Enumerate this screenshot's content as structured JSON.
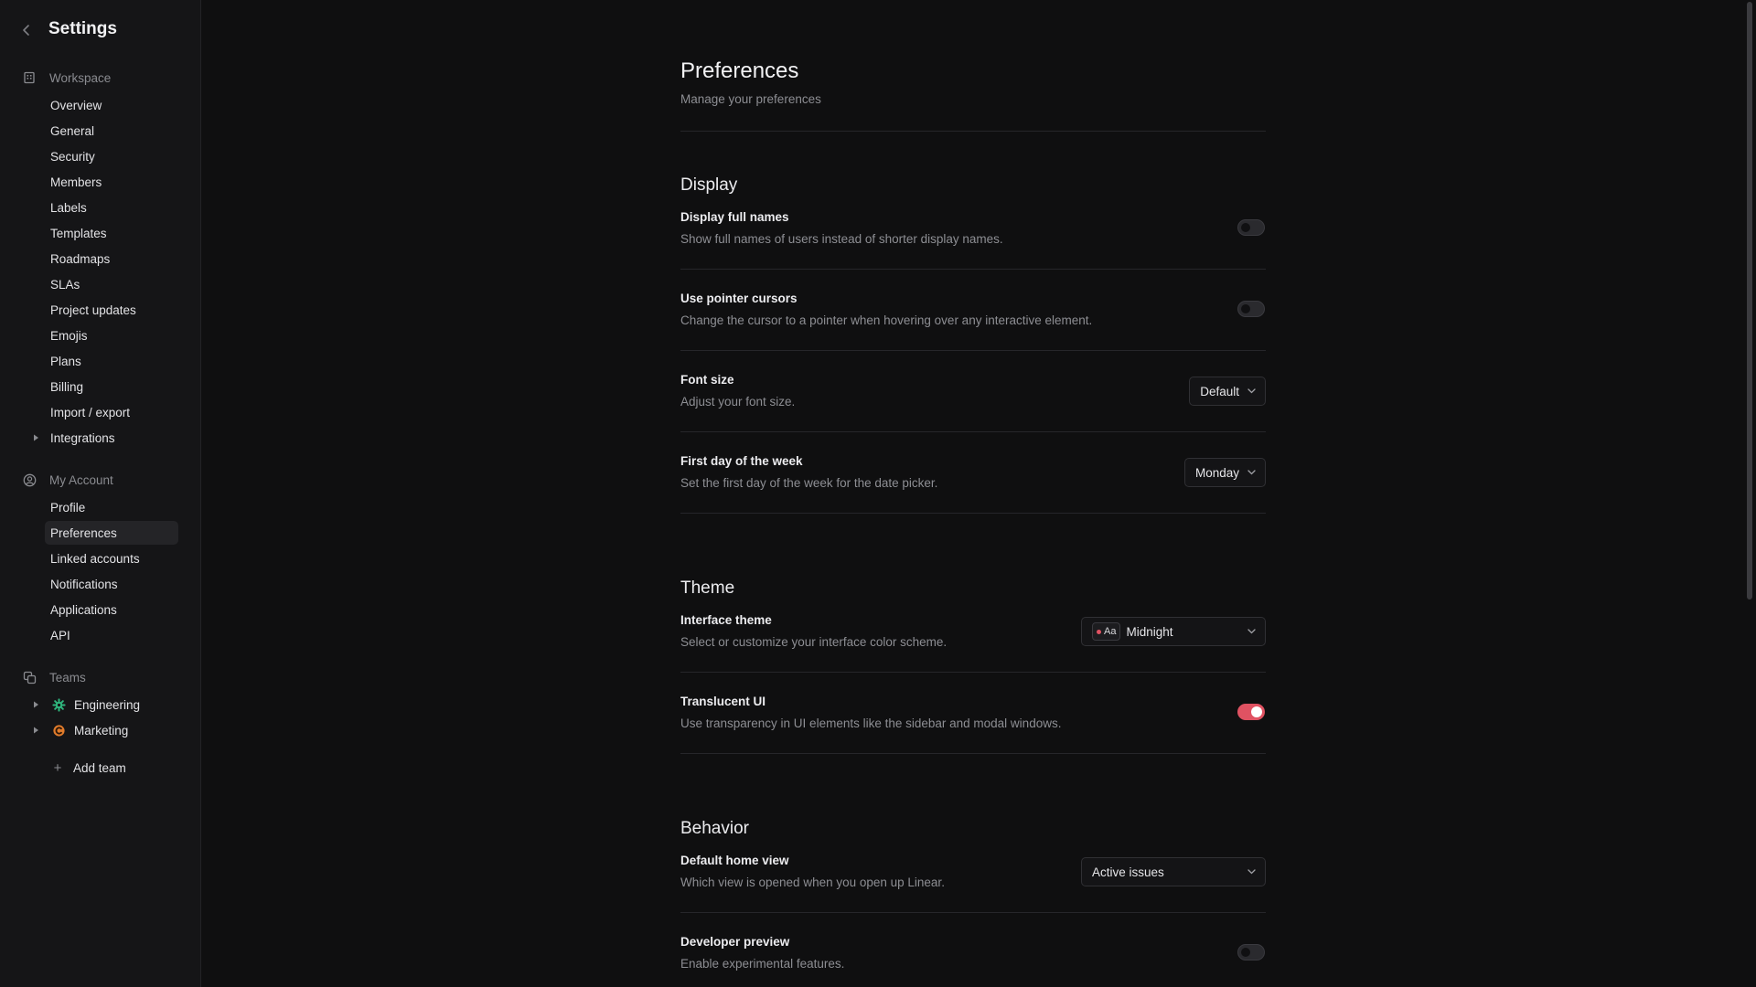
{
  "sidebar": {
    "title": "Settings",
    "workspace": {
      "label": "Workspace",
      "items": [
        "Overview",
        "General",
        "Security",
        "Members",
        "Labels",
        "Templates",
        "Roadmaps",
        "SLAs",
        "Project updates",
        "Emojis",
        "Plans",
        "Billing",
        "Import / export",
        "Integrations"
      ]
    },
    "account": {
      "label": "My Account",
      "items": [
        "Profile",
        "Preferences",
        "Linked accounts",
        "Notifications",
        "Applications",
        "API"
      ],
      "active": "Preferences"
    },
    "teams": {
      "label": "Teams",
      "items": [
        {
          "name": "Engineering",
          "icon": "gear-icon",
          "color": "#2fb47c"
        },
        {
          "name": "Marketing",
          "icon": "team-c-icon",
          "color": "#e07b2b"
        }
      ],
      "add_label": "Add team"
    }
  },
  "page": {
    "title": "Preferences",
    "subtitle": "Manage your preferences"
  },
  "sections": {
    "display": {
      "title": "Display",
      "full_names": {
        "title": "Display full names",
        "desc": "Show full names of users instead of shorter display names.",
        "on": false
      },
      "pointer": {
        "title": "Use pointer cursors",
        "desc": "Change the cursor to a pointer when hovering over any interactive element.",
        "on": false
      },
      "font_size": {
        "title": "Font size",
        "desc": "Adjust your font size.",
        "value": "Default"
      },
      "first_day": {
        "title": "First day of the week",
        "desc": "Set the first day of the week for the date picker.",
        "value": "Monday"
      }
    },
    "theme": {
      "title": "Theme",
      "interface": {
        "title": "Interface theme",
        "desc": "Select or customize your interface color scheme.",
        "chip": "Aa",
        "value": "Midnight"
      },
      "translucent": {
        "title": "Translucent UI",
        "desc": "Use transparency in UI elements like the sidebar and modal windows.",
        "on": true
      }
    },
    "behavior": {
      "title": "Behavior",
      "home_view": {
        "title": "Default home view",
        "desc": "Which view is opened when you open up Linear.",
        "value": "Active issues"
      },
      "dev_preview": {
        "title": "Developer preview",
        "desc": "Enable experimental features.",
        "on": false
      }
    }
  },
  "colors": {
    "accent": "#e05262",
    "background": "#0f0f10",
    "sidebar": "#151517"
  }
}
